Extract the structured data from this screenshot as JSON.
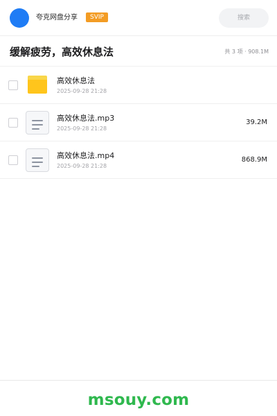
{
  "header": {
    "app_name": "夸克网盘分享",
    "badge": "SVIP",
    "search_placeholder": "搜索"
  },
  "folder": {
    "title": "缓解疲劳，高效休息法",
    "summary": "共 3 项 · 908.1M"
  },
  "files": [
    {
      "name": "高效休息法",
      "date": "2025-09-28 21:28",
      "size": "",
      "type": "folder-icon"
    },
    {
      "name": "高效休息法.mp3",
      "date": "2025-09-28 21:28",
      "size": "39.2M",
      "type": "document-icon"
    },
    {
      "name": "高效休息法.mp4",
      "date": "2025-09-28 21:28",
      "size": "868.9M",
      "type": "document-icon"
    }
  ],
  "footer": {
    "watermark": "msouy.com"
  },
  "colors": {
    "accent_blue": "#1f7cf5",
    "svip_orange": "#f39c24",
    "folder_yellow": "#ffc51c",
    "watermark_green": "#2fb84e"
  }
}
